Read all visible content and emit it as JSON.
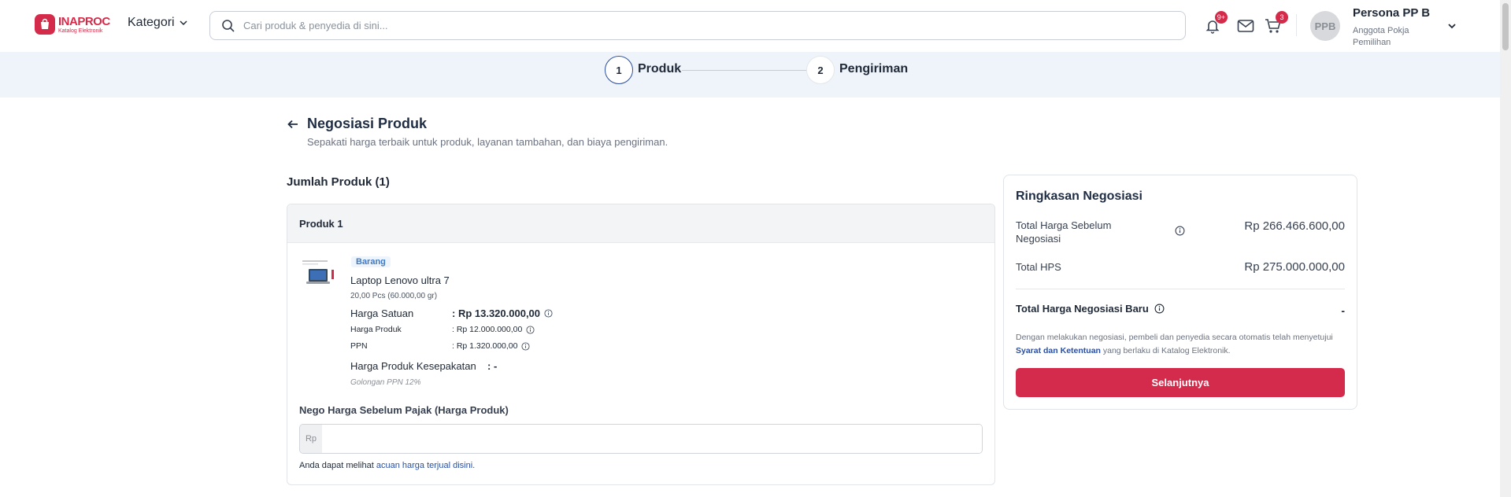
{
  "header": {
    "logo": {
      "main": "INAPROC",
      "sub": "Katalog Elektronik"
    },
    "kategori_label": "Kategori",
    "search": {
      "placeholder": "Cari produk & penyedia di sini..."
    },
    "notification_badge": "9+",
    "cart_badge": "3",
    "user": {
      "initials": "PPB",
      "name": "Persona PP B",
      "role": "Anggota Pokja Pemilihan"
    }
  },
  "stepper": {
    "steps": [
      {
        "number": "1",
        "label": "Produk",
        "active": true
      },
      {
        "number": "2",
        "label": "Pengiriman",
        "active": false
      }
    ]
  },
  "page": {
    "title": "Negosiasi Produk",
    "subtitle": "Sepakati harga terbaik untuk produk, layanan tambahan, dan biaya pengiriman.",
    "section_title": "Jumlah Produk (1)"
  },
  "product_card": {
    "header": "Produk 1",
    "tag": "Barang",
    "name": "Laptop Lenovo ultra 7",
    "qty": "20,00 Pcs (60.000,00 gr)",
    "harga_satuan": {
      "label": "Harga Satuan",
      "value": ": Rp 13.320.000,00"
    },
    "harga_produk": {
      "label": "Harga Produk",
      "value": ": Rp 12.000.000,00"
    },
    "ppn": {
      "label": "PPN",
      "value": ": Rp 1.320.000,00"
    },
    "kesepakatan": {
      "label": "Harga Produk Kesepakatan",
      "value": ": -"
    },
    "golongan": "Golongan PPN 12%",
    "nego_label": "Nego Harga Sebelum Pajak (Harga Produk)",
    "nego_prefix": "Rp",
    "nego_value": "",
    "hint_text": "Anda dapat melihat ",
    "hint_link": "acuan harga terjual disini."
  },
  "summary": {
    "title": "Ringkasan Negosiasi",
    "total_sebelum": {
      "label": "Total Harga Sebelum Negosiasi",
      "value": "Rp 266.466.600,00"
    },
    "total_hps": {
      "label": "Total HPS",
      "value": "Rp 275.000.000,00"
    },
    "total_baru": {
      "label": "Total Harga Negosiasi Baru",
      "value": "-"
    },
    "note_pre": "Dengan melakukan negosiasi, pembeli dan penyedia secara otomatis telah menyetujui ",
    "note_link": "Syarat dan Ketentuan",
    "note_post": " yang berlaku di Katalog Elektronik.",
    "button": "Selanjutnya"
  },
  "colors": {
    "brand": "#d52b4a",
    "primary_blue": "#2c4fa0",
    "tag_blue": "#3e7ac6",
    "stepper_bg": "#eef4fa"
  },
  "icons": [
    "bag-icon",
    "chevron-down-icon",
    "search-icon",
    "bell-icon",
    "mail-icon",
    "cart-icon",
    "arrow-left-icon",
    "info-icon"
  ]
}
